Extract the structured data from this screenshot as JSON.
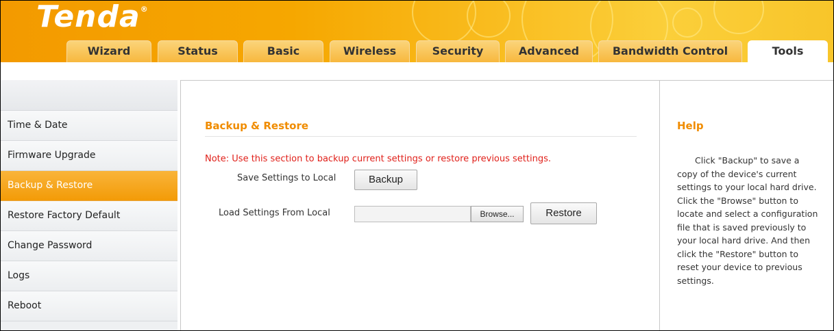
{
  "brand": {
    "logo_text": "Tenda",
    "trademark": "®"
  },
  "nav": {
    "tabs": [
      {
        "label": "Wizard"
      },
      {
        "label": "Status"
      },
      {
        "label": "Basic"
      },
      {
        "label": "Wireless"
      },
      {
        "label": "Security"
      },
      {
        "label": "Advanced"
      },
      {
        "label": "Bandwidth Control"
      },
      {
        "label": "Tools",
        "active": true
      }
    ]
  },
  "sidebar": {
    "items": [
      {
        "label": "Time & Date"
      },
      {
        "label": "Firmware Upgrade"
      },
      {
        "label": "Backup & Restore",
        "active": true
      },
      {
        "label": "Restore Factory Default"
      },
      {
        "label": "Change Password"
      },
      {
        "label": "Logs"
      },
      {
        "label": "Reboot"
      }
    ]
  },
  "main": {
    "title": "Backup & Restore",
    "note": "Note: Use this section to backup current settings or restore previous settings.",
    "save_label": "Save Settings to Local",
    "backup_button": "Backup",
    "load_label": "Load Settings From Local",
    "file_value": "",
    "browse_button": "Browse...",
    "restore_button": "Restore"
  },
  "help": {
    "title": "Help",
    "text": "Click \"Backup\" to save a copy of the device's current settings to your local hard drive. Click the \"Browse\" button to locate and select a configuration file that is saved previously to your local hard drive. And then click the \"Restore\" button to reset your device to previous settings."
  },
  "colors": {
    "accent": "#f08c00",
    "note_red": "#e0201a",
    "header_orange": "#f6a700"
  }
}
